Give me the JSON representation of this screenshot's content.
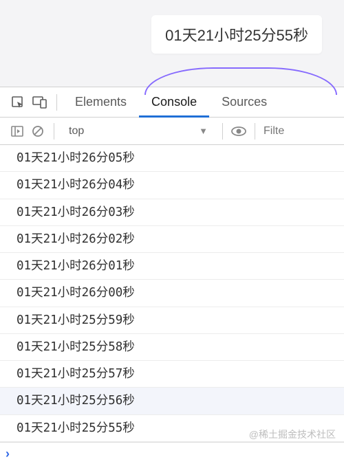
{
  "preview": {
    "countdown": "01天21小时25分55秒"
  },
  "tabs": {
    "elements": "Elements",
    "console": "Console",
    "sources": "Sources",
    "active": "Console"
  },
  "toolbar": {
    "context": "top",
    "filter_placeholder": "Filte"
  },
  "logs": [
    "01天21小时26分05秒",
    "01天21小时26分04秒",
    "01天21小时26分03秒",
    "01天21小时26分02秒",
    "01天21小时26分01秒",
    "01天21小时26分00秒",
    "01天21小时25分59秒",
    "01天21小时25分58秒",
    "01天21小时25分57秒",
    "01天21小时25分56秒",
    "01天21小时25分55秒"
  ],
  "highlighted_index": 9,
  "watermark": "@稀土掘金技术社区"
}
